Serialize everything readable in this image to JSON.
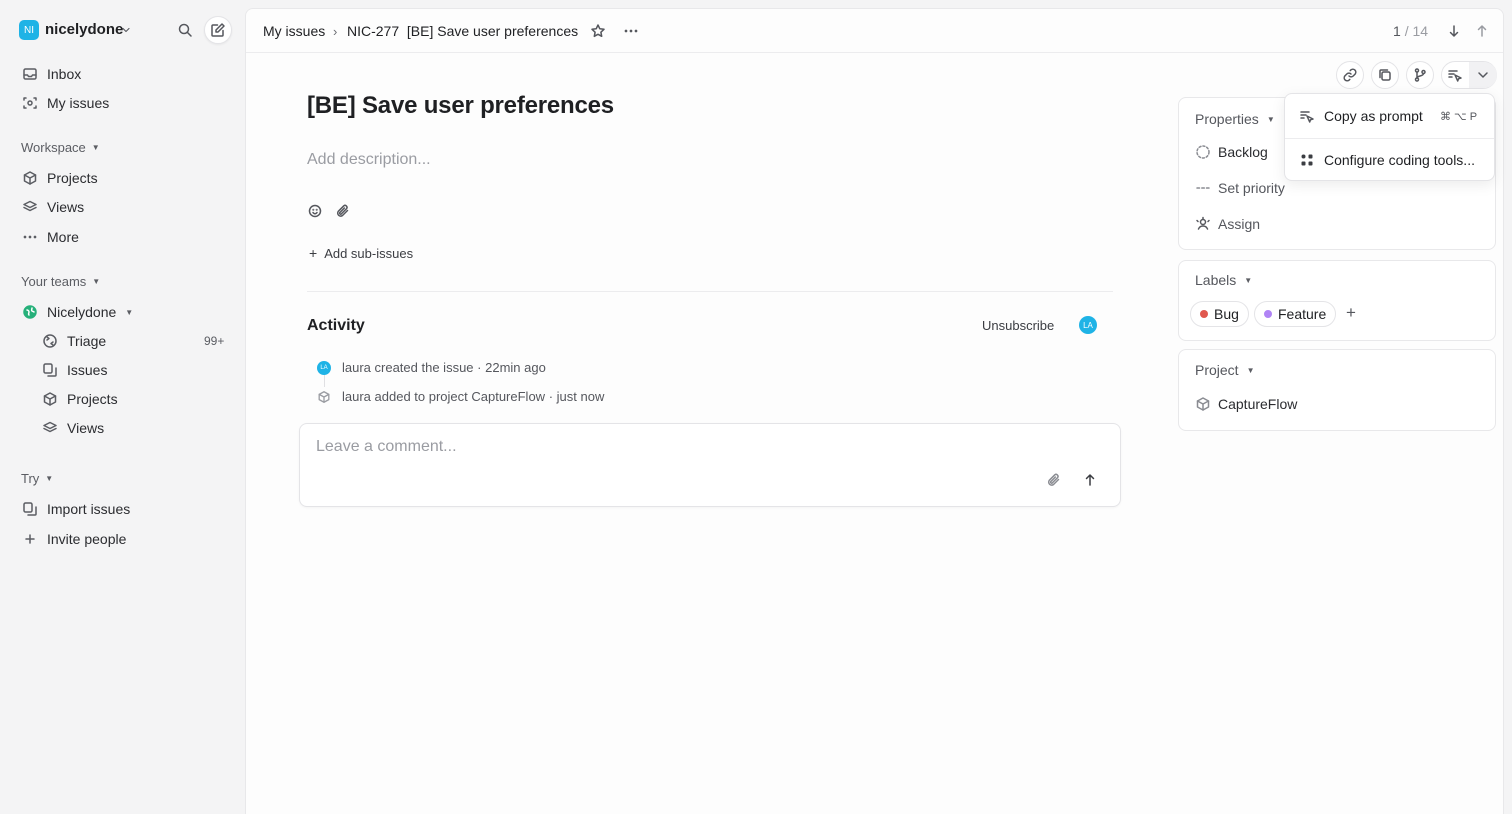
{
  "sidebar": {
    "workspace_initials": "NI",
    "workspace_name": "nicelydone",
    "inbox": "Inbox",
    "my_issues": "My issues",
    "workspace_section": "Workspace",
    "projects": "Projects",
    "views": "Views",
    "more": "More",
    "teams_section": "Your teams",
    "team_name": "Nicelydone",
    "triage": "Triage",
    "triage_count": "99+",
    "issues": "Issues",
    "team_projects": "Projects",
    "team_views": "Views",
    "try_section": "Try",
    "import_issues": "Import issues",
    "invite_people": "Invite people"
  },
  "topbar": {
    "crumb_parent": "My issues",
    "crumb_issue": "NIC-277  [BE] Save user preferences",
    "pager_current": "1",
    "pager_total": "/ 14"
  },
  "issue": {
    "title": "[BE] Save user preferences",
    "description_placeholder": "Add description...",
    "add_sub_issues": "Add sub-issues"
  },
  "activity": {
    "heading": "Activity",
    "unsubscribe": "Unsubscribe",
    "avatar": "LA",
    "events": [
      {
        "avatar": "LA",
        "text": "laura created the issue",
        "sep": "·",
        "time": "22min ago"
      },
      {
        "text": "laura added to project CaptureFlow",
        "sep": "·",
        "time": "just now"
      }
    ],
    "comment_placeholder": "Leave a comment..."
  },
  "properties": {
    "heading": "Properties",
    "status": "Backlog",
    "priority": "Set priority",
    "assign": "Assign"
  },
  "labels": {
    "heading": "Labels",
    "items": [
      {
        "name": "Bug",
        "color": "#e0584e"
      },
      {
        "name": "Feature",
        "color": "#b084f5"
      }
    ],
    "add": "+"
  },
  "project": {
    "heading": "Project",
    "name": "CaptureFlow"
  },
  "dropdown": {
    "copy_prompt": "Copy as prompt",
    "copy_shortcut": "⌘ ⌥ P",
    "configure": "Configure coding tools..."
  },
  "colors": {
    "accent": "#1fb3e6",
    "team_icon": "#26b07a"
  }
}
